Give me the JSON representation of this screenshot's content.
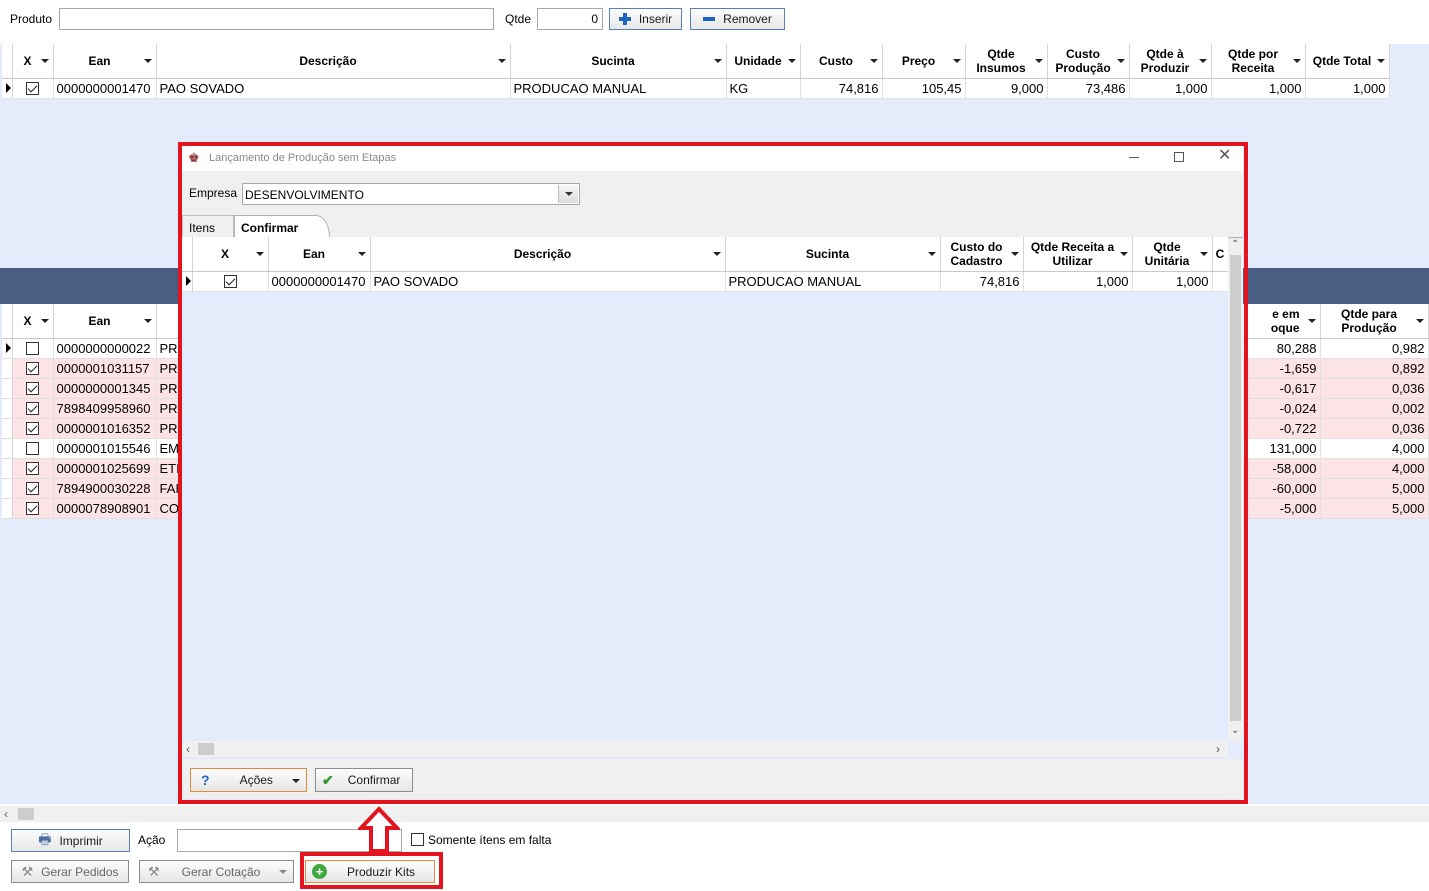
{
  "top": {
    "produto_label": "Produto",
    "produto_value": "",
    "qtde_label": "Qtde",
    "qtde_value": "0",
    "inserir_label": "Inserir",
    "remover_label": "Remover"
  },
  "grid1": {
    "columns": [
      "X",
      "Ean",
      "Descrição",
      "Sucinta",
      "Unidade",
      "Custo",
      "Preço",
      "Qtde Insumos",
      "Custo Produção",
      "Qtde à Produzir",
      "Qtde por Receita",
      "Qtde Total"
    ],
    "rows": [
      {
        "checked": true,
        "cells": [
          "0000000001470",
          "PAO SOVADO",
          "PRODUCAO MANUAL",
          "KG",
          "74,816",
          "105,45",
          "9,000",
          "73,486",
          "1,000",
          "1,000",
          "1,000"
        ]
      }
    ]
  },
  "grid2": {
    "columns": [
      "X",
      "Ean",
      "de em oque",
      "Qtde para Produção"
    ],
    "col3_line1": "e em",
    "col3_line2": "oque",
    "rows": [
      {
        "checked": false,
        "ean": "0000000000022",
        "desc": "PR",
        "estoque": "80,288",
        "prod": "0,982",
        "pink": false
      },
      {
        "checked": true,
        "ean": "0000001031157",
        "desc": "PR",
        "estoque": "-1,659",
        "prod": "0,892",
        "pink": true
      },
      {
        "checked": true,
        "ean": "0000000001345",
        "desc": "PR",
        "estoque": "-0,617",
        "prod": "0,036",
        "pink": true
      },
      {
        "checked": true,
        "ean": "7898409958960",
        "desc": "PR",
        "estoque": "-0,024",
        "prod": "0,002",
        "pink": true
      },
      {
        "checked": true,
        "ean": "0000001016352",
        "desc": "PR",
        "estoque": "-0,722",
        "prod": "0,036",
        "pink": true
      },
      {
        "checked": false,
        "ean": "0000001015546",
        "desc": "EM",
        "estoque": "131,000",
        "prod": "4,000",
        "pink": false
      },
      {
        "checked": true,
        "ean": "0000001025699",
        "desc": "ETI",
        "estoque": "-58,000",
        "prod": "4,000",
        "pink": true
      },
      {
        "checked": true,
        "ean": "7894900030228",
        "desc": "FAI",
        "estoque": "-60,000",
        "prod": "5,000",
        "pink": true
      },
      {
        "checked": true,
        "ean": "0000078908901",
        "desc": "CO",
        "estoque": "-5,000",
        "prod": "5,000",
        "pink": true
      }
    ]
  },
  "bottom": {
    "imprimir_label": "Imprimir",
    "acao_label": "Ação",
    "acao_value": "",
    "somente_label": "Somente ítens em falta",
    "gerar_pedidos_label": "Gerar Pedidos",
    "gerar_cotacao_label": "Gerar Cotação",
    "produzir_kits_label": "Produzir Kits"
  },
  "dialog": {
    "title": "Lançamento de Produção sem Etapas",
    "empresa_label": "Empresa",
    "empresa_value": "DESENVOLVIMENTO",
    "tabs": [
      "Itens",
      "Confirmar"
    ],
    "active_tab": "Confirmar",
    "columns": [
      "X",
      "Ean",
      "Descrição",
      "Sucinta",
      "Custo do Cadastro",
      "Qtde Receita a Utilizar",
      "Qtde Unitária",
      "C"
    ],
    "rows": [
      {
        "checked": true,
        "cells": [
          "0000000001470",
          "PAO SOVADO",
          "PRODUCAO MANUAL",
          "74,816",
          "1,000",
          "1,000"
        ]
      }
    ],
    "acoes_label": "Ações",
    "confirmar_label": "Confirmar"
  },
  "colors": {
    "panel_bg": "#e4ebfa",
    "header_bar": "#4a5d82",
    "highlight_red": "#e4141e",
    "row_pink": "#fbe3e6"
  }
}
